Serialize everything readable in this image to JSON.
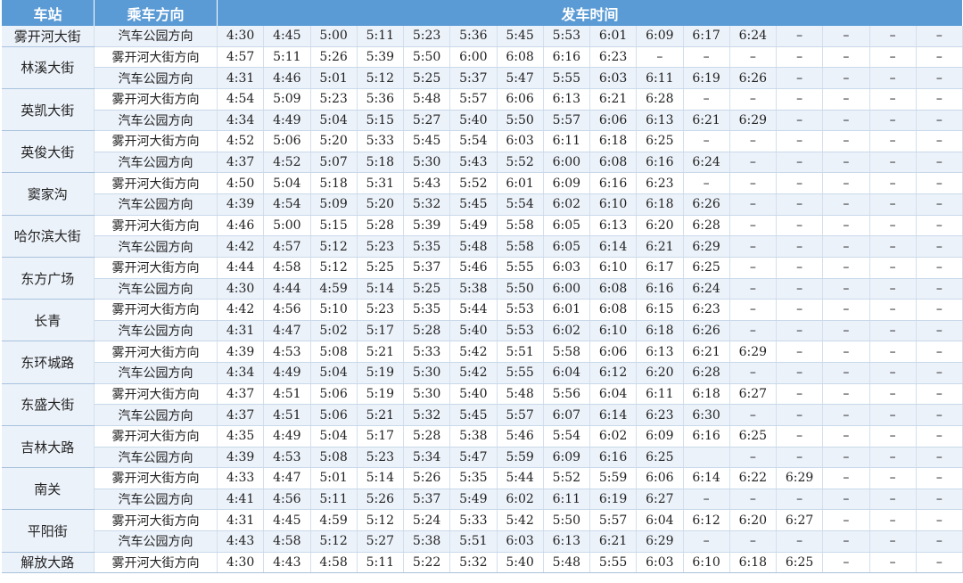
{
  "header": {
    "station": "车站",
    "direction": "乘车方向",
    "times": "发车时间"
  },
  "stations": [
    {
      "name": "雾开河大街",
      "rows": [
        {
          "dir": "汽车公园方向",
          "times": [
            "4:30",
            "4:45",
            "5:00",
            "5:11",
            "5:23",
            "5:36",
            "5:45",
            "5:53",
            "6:01",
            "6:09",
            "6:17",
            "6:24",
            "–",
            "–",
            "–",
            "–"
          ]
        }
      ]
    },
    {
      "name": "林溪大街",
      "rows": [
        {
          "dir": "雾开河大街方向",
          "times": [
            "4:57",
            "5:11",
            "5:26",
            "5:39",
            "5:50",
            "6:00",
            "6:08",
            "6:16",
            "6:23",
            "–",
            "–",
            "–",
            "–",
            "–",
            "–",
            "–"
          ]
        },
        {
          "dir": "汽车公园方向",
          "times": [
            "4:31",
            "4:46",
            "5:01",
            "5:12",
            "5:25",
            "5:37",
            "5:47",
            "5:55",
            "6:03",
            "6:11",
            "6:19",
            "6:26",
            "–",
            "–",
            "–",
            "–"
          ]
        }
      ]
    },
    {
      "name": "英凯大街",
      "rows": [
        {
          "dir": "雾开河大街方向",
          "times": [
            "4:54",
            "5:09",
            "5:23",
            "5:36",
            "5:48",
            "5:57",
            "6:06",
            "6:13",
            "6:21",
            "6:28",
            "–",
            "–",
            "–",
            "–",
            "–",
            "–"
          ]
        },
        {
          "dir": "汽车公园方向",
          "times": [
            "4:34",
            "4:49",
            "5:04",
            "5:15",
            "5:27",
            "5:40",
            "5:50",
            "5:57",
            "6:06",
            "6:13",
            "6:21",
            "6:29",
            "–",
            "–",
            "–",
            "–"
          ]
        }
      ]
    },
    {
      "name": "英俊大街",
      "rows": [
        {
          "dir": "雾开河大街方向",
          "times": [
            "4:52",
            "5:06",
            "5:20",
            "5:33",
            "5:45",
            "5:54",
            "6:03",
            "6:11",
            "6:18",
            "6:25",
            "–",
            "–",
            "–",
            "–",
            "–",
            "–"
          ]
        },
        {
          "dir": "汽车公园方向",
          "times": [
            "4:37",
            "4:52",
            "5:07",
            "5:18",
            "5:30",
            "5:43",
            "5:52",
            "6:00",
            "6:08",
            "6:16",
            "6:24",
            "–",
            "–",
            "–",
            "–",
            "–"
          ]
        }
      ]
    },
    {
      "name": "窦家沟",
      "rows": [
        {
          "dir": "雾开河大街方向",
          "times": [
            "4:50",
            "5:04",
            "5:18",
            "5:31",
            "5:43",
            "5:52",
            "6:01",
            "6:09",
            "6:16",
            "6:23",
            "–",
            "–",
            "–",
            "–",
            "–",
            "–"
          ]
        },
        {
          "dir": "汽车公园方向",
          "times": [
            "4:39",
            "4:54",
            "5:09",
            "5:20",
            "5:32",
            "5:45",
            "5:54",
            "6:02",
            "6:10",
            "6:18",
            "6:26",
            "–",
            "–",
            "–",
            "–",
            "–"
          ]
        }
      ]
    },
    {
      "name": "哈尔滨大街",
      "rows": [
        {
          "dir": "雾开河大街方向",
          "times": [
            "4:46",
            "5:00",
            "5:15",
            "5:28",
            "5:39",
            "5:49",
            "5:58",
            "6:05",
            "6:13",
            "6:20",
            "6:28",
            "–",
            "–",
            "–",
            "–",
            "–"
          ]
        },
        {
          "dir": "汽车公园方向",
          "times": [
            "4:42",
            "4:57",
            "5:12",
            "5:23",
            "5:35",
            "5:48",
            "5:58",
            "6:05",
            "6:14",
            "6:21",
            "6:29",
            "–",
            "–",
            "–",
            "–",
            "–"
          ]
        }
      ]
    },
    {
      "name": "东方广场",
      "rows": [
        {
          "dir": "雾开河大街方向",
          "times": [
            "4:44",
            "4:58",
            "5:12",
            "5:25",
            "5:37",
            "5:46",
            "5:55",
            "6:03",
            "6:10",
            "6:17",
            "6:25",
            "–",
            "–",
            "–",
            "–",
            "–"
          ]
        },
        {
          "dir": "汽车公园方向",
          "times": [
            "4:30",
            "4:44",
            "4:59",
            "5:14",
            "5:25",
            "5:38",
            "5:50",
            "6:00",
            "6:08",
            "6:16",
            "6:24",
            "–",
            "–",
            "–",
            "–",
            "–"
          ]
        }
      ]
    },
    {
      "name": "长青",
      "rows": [
        {
          "dir": "雾开河大街方向",
          "times": [
            "4:42",
            "4:56",
            "5:10",
            "5:23",
            "5:35",
            "5:44",
            "5:53",
            "6:01",
            "6:08",
            "6:15",
            "6:23",
            "–",
            "–",
            "–",
            "–",
            "–"
          ]
        },
        {
          "dir": "汽车公园方向",
          "times": [
            "4:31",
            "4:47",
            "5:02",
            "5:17",
            "5:28",
            "5:40",
            "5:53",
            "6:02",
            "6:10",
            "6:18",
            "6:26",
            "–",
            "–",
            "–",
            "–",
            "–"
          ]
        }
      ]
    },
    {
      "name": "东环城路",
      "rows": [
        {
          "dir": "雾开河大街方向",
          "times": [
            "4:39",
            "4:53",
            "5:08",
            "5:21",
            "5:33",
            "5:42",
            "5:51",
            "5:58",
            "6:06",
            "6:13",
            "6:21",
            "6:29",
            "–",
            "–",
            "–",
            "–"
          ]
        },
        {
          "dir": "汽车公园方向",
          "times": [
            "4:34",
            "4:49",
            "5:04",
            "5:19",
            "5:30",
            "5:42",
            "5:55",
            "6:04",
            "6:12",
            "6:20",
            "6:28",
            "–",
            "–",
            "–",
            "–",
            "–"
          ]
        }
      ]
    },
    {
      "name": "东盛大街",
      "rows": [
        {
          "dir": "雾开河大街方向",
          "times": [
            "4:37",
            "4:51",
            "5:06",
            "5:19",
            "5:30",
            "5:40",
            "5:48",
            "5:56",
            "6:04",
            "6:11",
            "6:18",
            "6:27",
            "–",
            "–",
            "–",
            "–"
          ]
        },
        {
          "dir": "汽车公园方向",
          "times": [
            "4:37",
            "4:51",
            "5:06",
            "5:21",
            "5:32",
            "5:45",
            "5:57",
            "6:07",
            "6:14",
            "6:23",
            "6:30",
            "–",
            "–",
            "–",
            "–",
            "–"
          ]
        }
      ]
    },
    {
      "name": "吉林大路",
      "rows": [
        {
          "dir": "雾开河大街方向",
          "times": [
            "4:35",
            "4:49",
            "5:04",
            "5:17",
            "5:28",
            "5:38",
            "5:46",
            "5:54",
            "6:02",
            "6:09",
            "6:16",
            "6:25",
            "–",
            "–",
            "–",
            "–"
          ]
        },
        {
          "dir": "汽车公园方向",
          "times": [
            "4:39",
            "4:53",
            "5:08",
            "5:23",
            "5:34",
            "5:47",
            "5:59",
            "6:09",
            "6:16",
            "6:25",
            "",
            "–",
            "–",
            "–",
            "–",
            "–"
          ]
        }
      ]
    },
    {
      "name": "南关",
      "rows": [
        {
          "dir": "雾开河大街方向",
          "times": [
            "4:33",
            "4:47",
            "5:01",
            "5:14",
            "5:26",
            "5:35",
            "5:44",
            "5:52",
            "5:59",
            "6:06",
            "6:14",
            "6:22",
            "6:29",
            "–",
            "–",
            "–"
          ]
        },
        {
          "dir": "汽车公园方向",
          "times": [
            "4:41",
            "4:56",
            "5:11",
            "5:26",
            "5:37",
            "5:49",
            "6:02",
            "6:11",
            "6:19",
            "6:27",
            "–",
            "–",
            "–",
            "–",
            "–",
            "–"
          ]
        }
      ]
    },
    {
      "name": "平阳街",
      "rows": [
        {
          "dir": "雾开河大街方向",
          "times": [
            "4:31",
            "4:45",
            "4:59",
            "5:12",
            "5:24",
            "5:33",
            "5:42",
            "5:50",
            "5:57",
            "6:04",
            "6:12",
            "6:20",
            "6:27",
            "–",
            "–",
            "–"
          ]
        },
        {
          "dir": "汽车公园方向",
          "times": [
            "4:43",
            "4:58",
            "5:12",
            "5:27",
            "5:38",
            "5:51",
            "6:03",
            "6:13",
            "6:21",
            "6:29",
            "–",
            "–",
            "–",
            "–",
            "–",
            "–"
          ]
        }
      ]
    },
    {
      "name": "解放大路",
      "rows": [
        {
          "dir": "雾开河大街方向",
          "times": [
            "4:30",
            "4:43",
            "4:58",
            "5:11",
            "5:22",
            "5:32",
            "5:40",
            "5:48",
            "5:55",
            "6:03",
            "6:10",
            "6:18",
            "6:25",
            "–",
            "–",
            "–"
          ]
        }
      ]
    }
  ]
}
